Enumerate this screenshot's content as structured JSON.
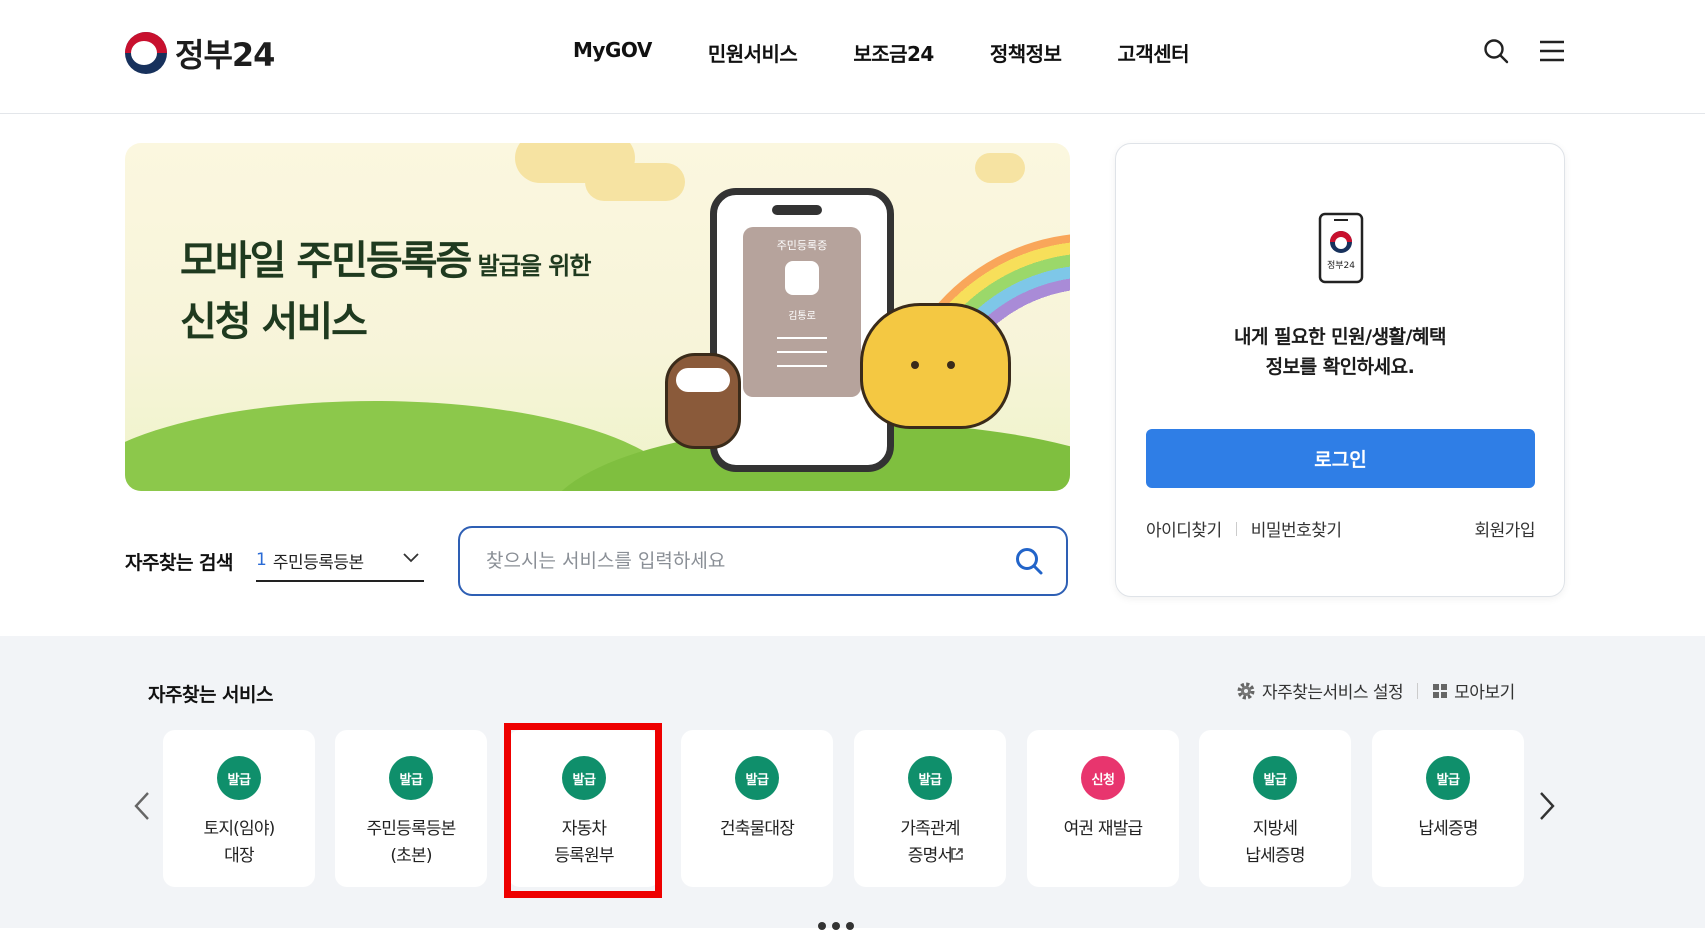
{
  "header": {
    "logo_text": "정부24",
    "nav": [
      "MyGOV",
      "민원서비스",
      "보조금24",
      "정책정보",
      "고객센터"
    ],
    "icons": [
      "search-icon",
      "menu-icon"
    ]
  },
  "banner": {
    "title_line1_big": "모바일 주민등록증",
    "title_line1_small": " 발급을 위한",
    "title_line2": "신청 서비스",
    "card_title": "주민등록증",
    "card_name": "김통로"
  },
  "search": {
    "frequent_label": "자주찾는 검색",
    "frequent_rank": "1",
    "frequent_value": "주민등록등본",
    "placeholder": "찾으시는 서비스를 입력하세요"
  },
  "login": {
    "icon_caption": "정부24",
    "message_line1": "내게 필요한 민원/생활/혜택",
    "message_line2": "정보를 확인하세요.",
    "button": "로그인",
    "find_id": "아이디찾기",
    "find_pw": "비밀번호찾기",
    "signup": "회원가입"
  },
  "services": {
    "title": "자주찾는 서비스",
    "settings": "자주찾는서비스 설정",
    "view_all": "모아보기",
    "colors": {
      "issue": "#0f8f6b",
      "apply": "#e8356e",
      "highlight": "#ee0000"
    },
    "items": [
      {
        "badge": "발급",
        "type": "issue",
        "label": "토지(임야)\n대장"
      },
      {
        "badge": "발급",
        "type": "issue",
        "label": "주민등록등본\n(초본)"
      },
      {
        "badge": "발급",
        "type": "issue",
        "label": "자동차\n등록원부"
      },
      {
        "badge": "발급",
        "type": "issue",
        "label": "건축물대장"
      },
      {
        "badge": "발급",
        "type": "issue",
        "label": "가족관계\n증명서"
      },
      {
        "badge": "신청",
        "type": "apply",
        "label": "여권 재발급"
      },
      {
        "badge": "발급",
        "type": "issue",
        "label": "지방세\n납세증명"
      },
      {
        "badge": "발급",
        "type": "issue",
        "label": "납세증명"
      }
    ]
  }
}
